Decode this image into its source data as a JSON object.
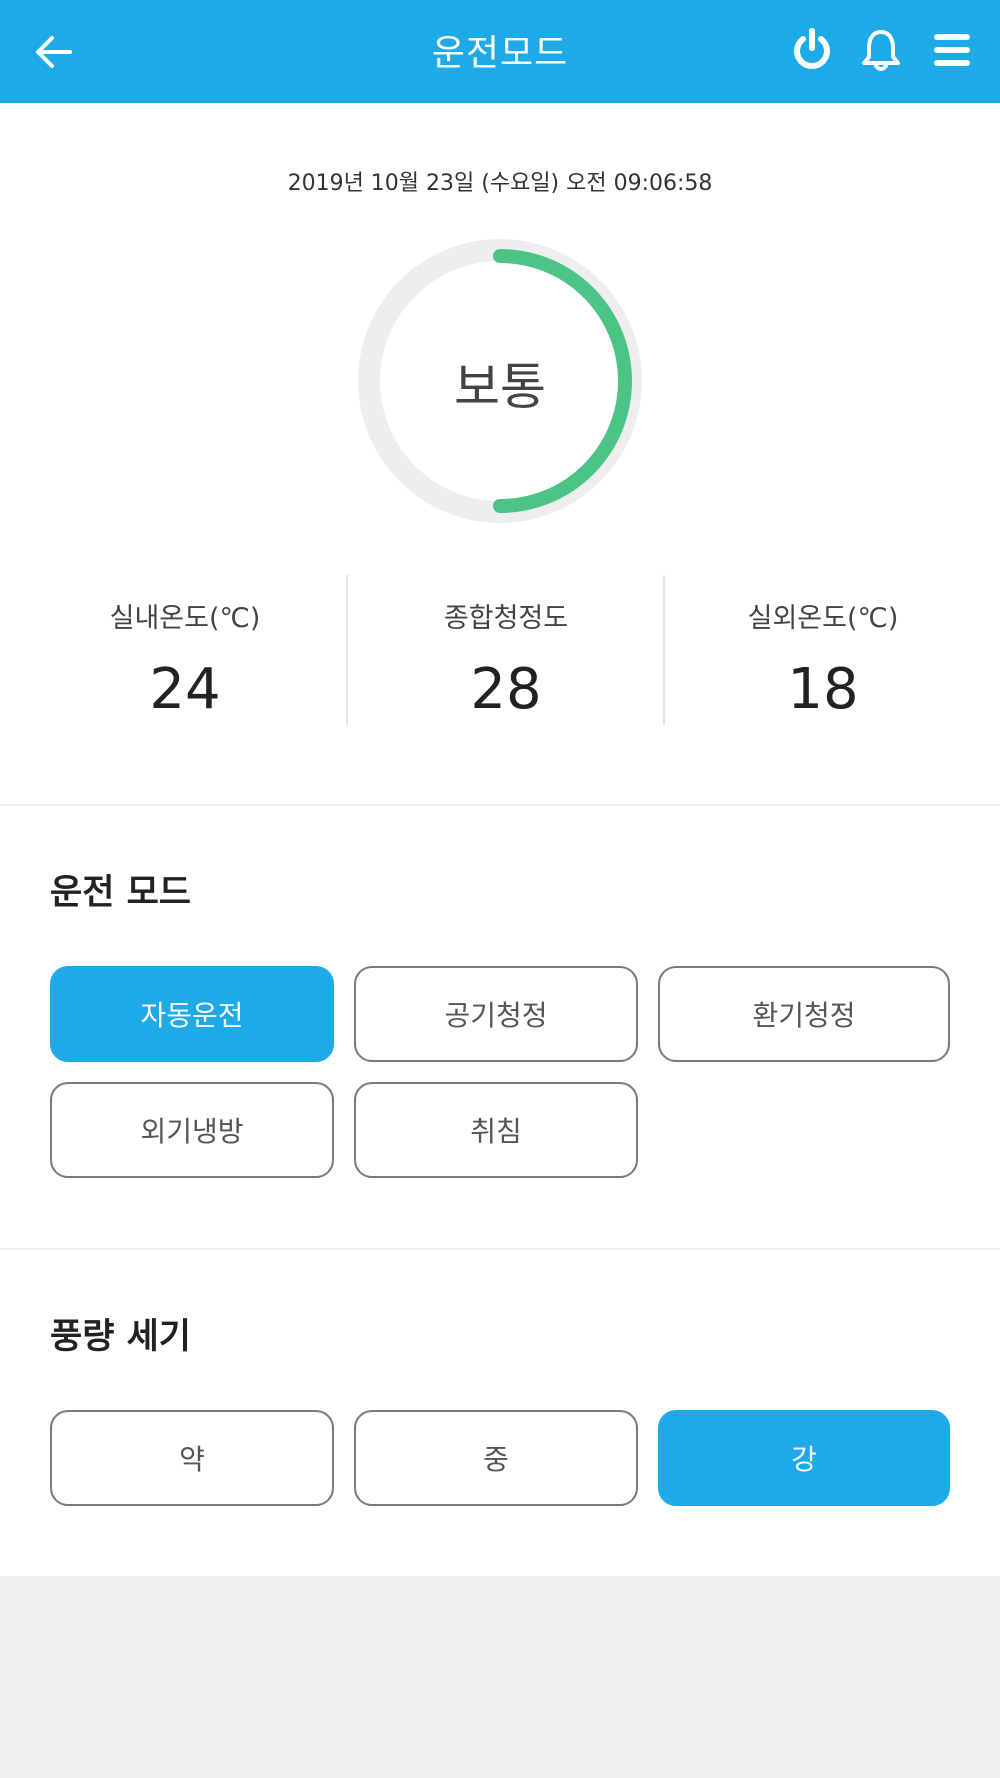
{
  "header": {
    "title": "운전모드",
    "icons": [
      "back-arrow-icon",
      "power-icon",
      "bell-icon",
      "menu-icon"
    ]
  },
  "status": {
    "datetime": "2019년 10월 23일 (수요일) 오전 09:06:58",
    "air_quality_label": "보통",
    "air_quality_level": 0.5,
    "stats": [
      {
        "label": "실내온도(℃)",
        "value": "24"
      },
      {
        "label": "종합청정도",
        "value": "28"
      },
      {
        "label": "실외온도(℃)",
        "value": "18"
      }
    ]
  },
  "mode": {
    "title": "운전 모드",
    "options": [
      "자동운전",
      "공기청정",
      "환기청정",
      "외기냉방",
      "취침"
    ],
    "selected": "자동운전"
  },
  "wind": {
    "title": "풍량 세기",
    "options": [
      "약",
      "중",
      "강"
    ],
    "selected": "강"
  },
  "colors": {
    "header": "#1eaae7",
    "accent": "#1eaae7",
    "gauge_fill": "#4cc486",
    "gauge_track": "#eeeeee",
    "background": "#efefef"
  }
}
